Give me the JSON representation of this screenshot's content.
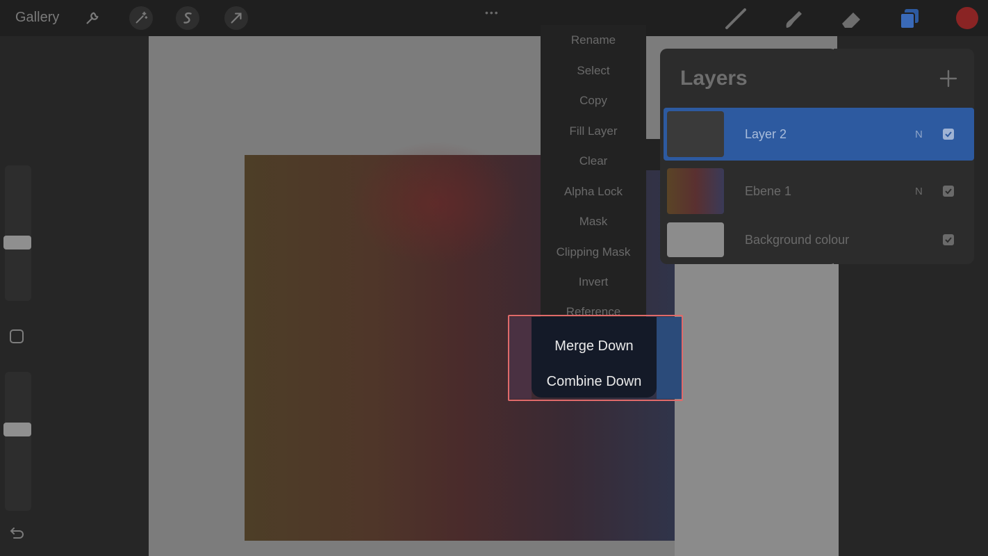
{
  "topbar": {
    "gallery_label": "Gallery",
    "tools": [
      "wrench-icon",
      "magic-wand-icon",
      "selection-icon",
      "transform-icon"
    ],
    "more_dots": "•••",
    "right_tools": [
      "brush-icon",
      "smudge-icon",
      "eraser-icon",
      "layers-icon",
      "color-swatch"
    ]
  },
  "colors": {
    "accent": "#2d5aa0",
    "color_swatch": "#8a2424",
    "highlight": "#e06a6a"
  },
  "sidebar": {
    "controls": [
      "brush-size-slider",
      "modify-button",
      "opacity-slider",
      "undo-icon"
    ]
  },
  "layers": {
    "title": "Layers",
    "items": [
      {
        "name": "Layer 2",
        "mode": "N",
        "visible": true,
        "selected": true
      },
      {
        "name": "Ebene 1",
        "mode": "N",
        "visible": true,
        "selected": false
      },
      {
        "name": "Background colour",
        "mode": "",
        "visible": true,
        "selected": false
      }
    ]
  },
  "menu": {
    "items": [
      "Rename",
      "Select",
      "Copy",
      "Fill Layer",
      "Clear",
      "Alpha Lock",
      "Mask",
      "Clipping Mask",
      "Invert",
      "Reference"
    ],
    "popup": [
      "Merge Down",
      "Combine Down"
    ]
  }
}
